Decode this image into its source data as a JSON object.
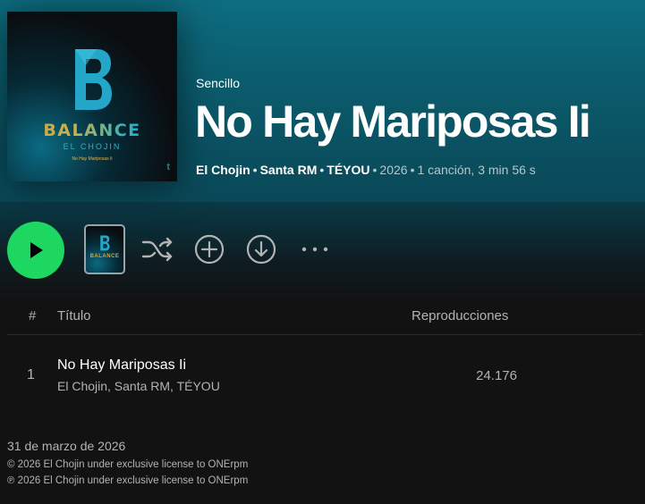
{
  "colors": {
    "accent": "#1ed760",
    "hero": "#0d6d80",
    "background": "#121212",
    "text_dim": "#b3b3b3"
  },
  "cover": {
    "brand": "BALANCE",
    "artist": "EL CHOJIN",
    "track": "No Hay Mariposas Ii"
  },
  "header": {
    "type": "Sencillo",
    "title": "No Hay Mariposas Ii",
    "artists": [
      "El Chojin",
      "Santa RM",
      "TÉYOU"
    ],
    "year": "2026",
    "summary": "1 canción, 3 min 56 s"
  },
  "actions": {
    "play_icon": "play-icon",
    "thumb_brand": "BALANCE",
    "shuffle_icon": "shuffle-icon",
    "add_icon": "add-circle-icon",
    "download_icon": "download-icon",
    "more_icon": "more-icon"
  },
  "tracklist": {
    "columns": {
      "number": "#",
      "title": "Título",
      "plays": "Reproducciones"
    },
    "rows": [
      {
        "number": "1",
        "title": "No Hay Mariposas Ii",
        "artists": "El Chojin, Santa RM, TÉYOU",
        "plays": "24.176"
      }
    ]
  },
  "footer": {
    "release_date": "31 de marzo de 2026",
    "copyright_c": "© 2026 El Chojin under exclusive license to ONErpm",
    "copyright_p": "℗ 2026 El Chojin under exclusive license to ONErpm"
  }
}
